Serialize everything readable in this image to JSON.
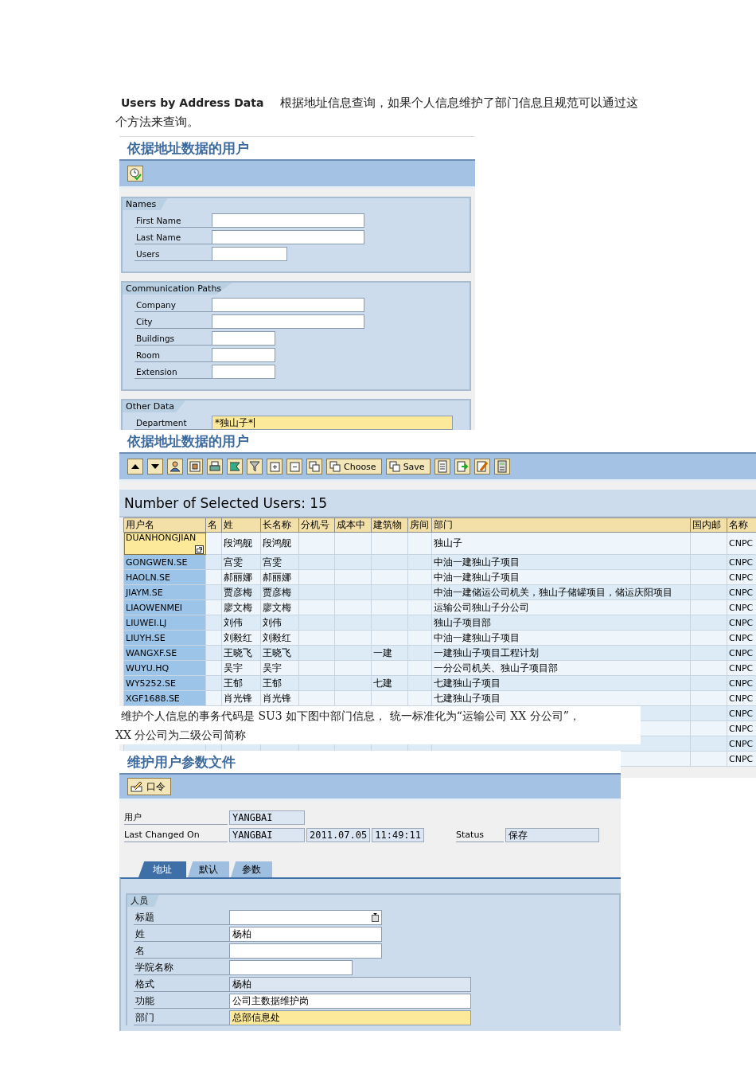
{
  "intro": {
    "text": "**Users by Address Data**　根据地址信息查询，如果个人信息维护了部门信息且规范可以通过这个方法来查询。"
  },
  "search_screen": {
    "title": "依据地址数据的用户",
    "groups": [
      {
        "title": "Names",
        "fields": [
          {
            "label": "First Name",
            "highlighted": false
          },
          {
            "label": "Last Name",
            "highlighted": false
          },
          {
            "label": "Users",
            "highlighted": false
          }
        ]
      },
      {
        "title": "Communication Paths",
        "fields": [
          {
            "label": "Company",
            "highlighted": false
          },
          {
            "label": "City",
            "highlighted": false
          },
          {
            "label": "Buildings",
            "highlighted": false
          },
          {
            "label": "Room",
            "highlighted": false
          },
          {
            "label": "Extension",
            "highlighted": false
          }
        ]
      },
      {
        "title": "Other Data",
        "fields": [
          {
            "label": "Department",
            "value": "*独山子*",
            "highlighted": true
          }
        ]
      }
    ]
  },
  "result_screen": {
    "title": "依据地址数据的用户",
    "toolbar": [
      {
        "label": "Choose"
      },
      {
        "label": "Save"
      }
    ],
    "count_text": "Number of Selected Users: 15",
    "table": {
      "columns": [
        "用户名",
        "名",
        "姓",
        "长名称",
        "分机号",
        "成本中",
        "建筑物",
        "房间",
        "部门",
        "国内邮",
        "名称"
      ],
      "rows": [
        {
          "selected": true,
          "cells": [
            "DUANHONGJIAN",
            null,
            "段鸿舰",
            "段鸿舰",
            null,
            null,
            null,
            null,
            "独山子",
            null,
            "CNPC"
          ]
        },
        {
          "selected": false,
          "cells": [
            "GONGWEN.SE",
            null,
            "宫雯",
            "宫雯",
            null,
            null,
            null,
            null,
            "中油一建独山子项目",
            null,
            "CNPC"
          ]
        },
        {
          "selected": false,
          "cells": [
            "HAOLN.SE",
            null,
            "郝丽娜",
            "郝丽娜",
            null,
            null,
            null,
            null,
            "中油一建独山子项目",
            null,
            "CNPC"
          ]
        },
        {
          "selected": false,
          "cells": [
            "JIAYM.SE",
            null,
            "贾彦梅",
            "贾彦梅",
            null,
            null,
            null,
            null,
            "中油一建储运公司机关，独山子储罐项目，储运庆阳项目",
            null,
            "CNPC"
          ]
        },
        {
          "selected": false,
          "cells": [
            "LIAOWENMEI",
            null,
            "廖文梅",
            "廖文梅",
            null,
            null,
            null,
            null,
            "运输公司独山子分公司",
            null,
            "CNPC"
          ]
        },
        {
          "selected": false,
          "cells": [
            "LIUWEI.LJ",
            null,
            "刘伟",
            "刘伟",
            null,
            null,
            null,
            null,
            "独山子项目部",
            null,
            "CNPC"
          ]
        },
        {
          "selected": false,
          "cells": [
            "LIUYH.SE",
            null,
            "刘毅红",
            "刘毅红",
            null,
            null,
            null,
            null,
            "中油一建独山子项目",
            null,
            "CNPC"
          ]
        },
        {
          "selected": false,
          "cells": [
            "WANGXF.SE",
            null,
            "王晓飞",
            "王晓飞",
            null,
            null,
            "一建",
            null,
            "一建独山子项目工程计划",
            null,
            "CNPC"
          ]
        },
        {
          "selected": false,
          "cells": [
            "WUYU.HQ",
            null,
            "吴宇",
            "吴宇",
            null,
            null,
            null,
            null,
            "一分公司机关、独山子项目部",
            null,
            "CNPC"
          ]
        },
        {
          "selected": false,
          "cells": [
            "WY5252.SE",
            null,
            "王郁",
            "王郁",
            null,
            null,
            "七建",
            null,
            "七建独山子项目",
            null,
            "CNPC"
          ]
        },
        {
          "selected": false,
          "cells": [
            "XGF1688.SE",
            null,
            "肖光锋",
            "肖光锋",
            null,
            null,
            null,
            null,
            "七建独山子项目",
            null,
            "CNPC"
          ]
        },
        {
          "cells": [
            null,
            null,
            null,
            null,
            null,
            null,
            null,
            null,
            null,
            null,
            "CNPC"
          ]
        },
        {
          "cells": [
            null,
            null,
            null,
            null,
            null,
            null,
            null,
            null,
            null,
            null,
            "CNPC"
          ]
        },
        {
          "cells": [
            null,
            null,
            null,
            null,
            null,
            null,
            null,
            null,
            null,
            null,
            "CNPC"
          ]
        },
        {
          "cells": [
            null,
            null,
            null,
            null,
            null,
            null,
            null,
            null,
            null,
            null,
            "CNPC"
          ]
        }
      ]
    }
  },
  "note": {
    "lines": [
      "维护个人信息的事务代码是 SU3 如下图中部门信息， 统一标准化为“运输公司 XX 分公司”，",
      "XX 分公司为二级公司简称"
    ]
  },
  "profile_screen": {
    "title": "维护用户参数文件",
    "toolbar": [
      {
        "label": "口令"
      }
    ],
    "header_fields": [
      {
        "label": "用户",
        "values": [
          "YANGBAI"
        ]
      },
      {
        "label": "Last Changed On",
        "values": [
          "YANGBAI",
          "2011.07.05",
          "11:49:11"
        ]
      }
    ],
    "status": {
      "label": "Status",
      "value": "保存"
    },
    "tabs": [
      {
        "label": "地址",
        "selected": true
      },
      {
        "label": "默认",
        "selected": false
      },
      {
        "label": "参数",
        "selected": false
      }
    ],
    "group": {
      "title": "人员",
      "fields": [
        {
          "label": "标题",
          "kind": "dropdown",
          "highlighted": false
        },
        {
          "label": "姓",
          "kind": "input",
          "value": "杨柏",
          "highlighted": false
        },
        {
          "label": "名",
          "kind": "input",
          "highlighted": false
        },
        {
          "label": "学院名称",
          "kind": "input",
          "highlighted": false
        },
        {
          "label": "格式",
          "kind": "display",
          "value": "杨柏",
          "highlighted": false
        },
        {
          "label": "功能",
          "kind": "input",
          "value": "公司主数据维护岗",
          "highlighted": false
        },
        {
          "label": "部门",
          "kind": "input",
          "value": "总部信息处",
          "highlighted": true
        }
      ]
    }
  }
}
